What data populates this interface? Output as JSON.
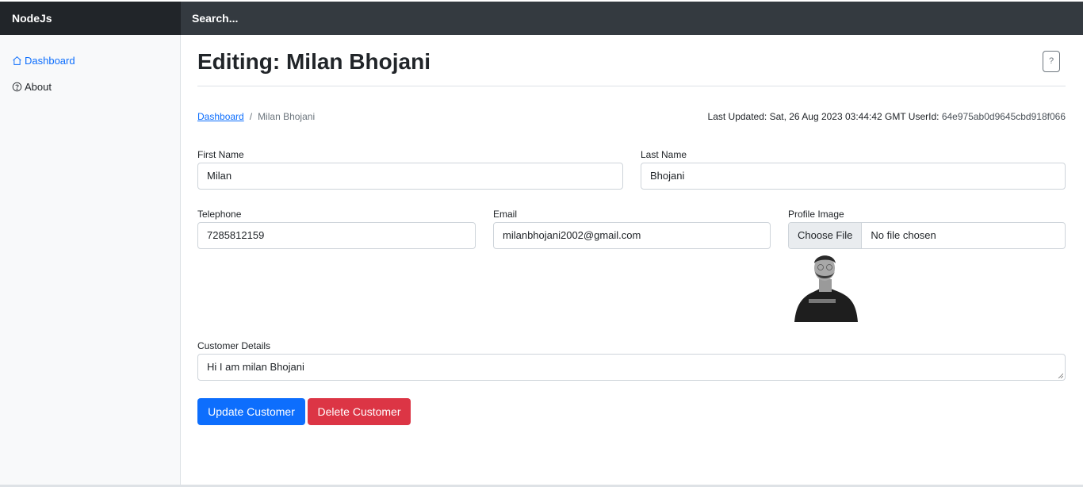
{
  "header": {
    "brand": "NodeJs",
    "search_placeholder": "Search..."
  },
  "sidebar": {
    "items": [
      {
        "label": "Dashboard",
        "icon": "house-icon",
        "active": true
      },
      {
        "label": "About",
        "icon": "question-circle-icon",
        "active": false
      }
    ]
  },
  "page": {
    "title": "Editing: Milan Bhojani",
    "help_label": "?"
  },
  "breadcrumb": {
    "link": "Dashboard",
    "separator": "/",
    "current": "Milan Bhojani"
  },
  "meta": {
    "last_updated_label": "Last Updated: Sat, 26 Aug 2023 03:44:42 GMT UserId:",
    "user_id": "64e975ab0d9645cbd918f066"
  },
  "form": {
    "first_name_label": "First Name",
    "first_name_value": "Milan",
    "last_name_label": "Last Name",
    "last_name_value": "Bhojani",
    "telephone_label": "Telephone",
    "telephone_value": "7285812159",
    "email_label": "Email",
    "email_value": "milanbhojani2002@gmail.com",
    "profile_image_label": "Profile Image",
    "file_button": "Choose File",
    "file_status": "No file chosen",
    "details_label": "Customer Details",
    "details_value": "Hi I am milan Bhojani"
  },
  "actions": {
    "update_label": "Update Customer",
    "delete_label": "Delete Customer"
  },
  "colors": {
    "primary": "#0d6efd",
    "danger": "#dc3545",
    "topbar": "#343a40",
    "brand_bg": "#212529"
  }
}
